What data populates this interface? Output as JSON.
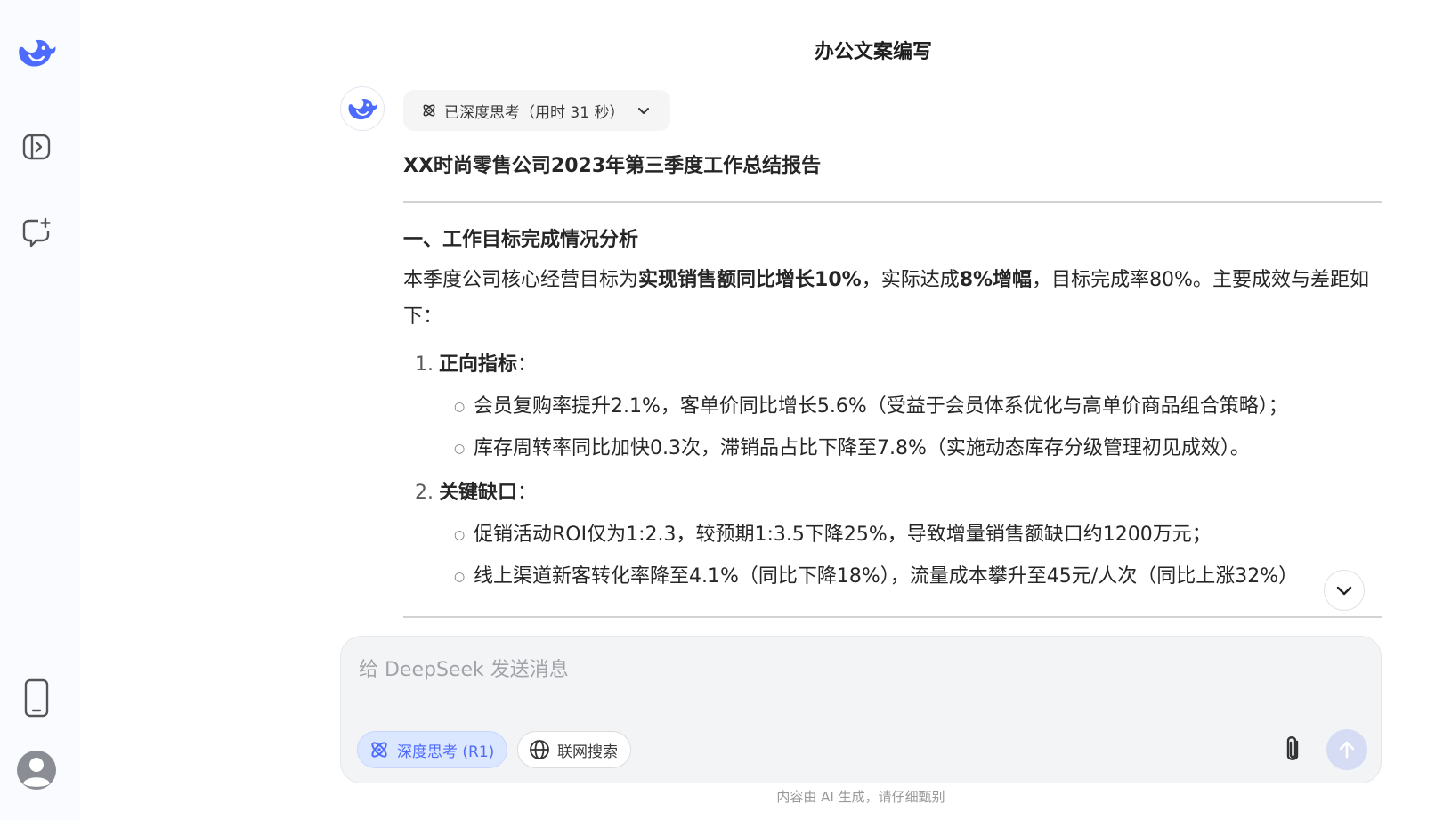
{
  "colors": {
    "accent": "#4d6bfe",
    "sidebar_bg": "#f9fbff",
    "text": "#262626"
  },
  "sidebar": {
    "logo_icon": "deepseek-whale-icon",
    "toggle_icon": "sidebar-toggle-icon",
    "new_chat_icon": "new-chat-icon",
    "mobile_icon": "mobile-phone-icon",
    "avatar_icon": "user-avatar-icon"
  },
  "page": {
    "title": "办公文案编写"
  },
  "message": {
    "think_label": "已深度思考（用时 31 秒）",
    "report_title": "XX时尚零售公司2023年第三季度工作总结报告",
    "section1_title": "一、工作目标完成情况分析",
    "intro": {
      "t1": "本季度公司核心经营目标为",
      "b1": "实现销售额同比增长10%",
      "t2": "，实际达成",
      "b2": "8%增幅",
      "t3": "，目标完成率80%。主要成效与差距如下："
    },
    "list": [
      {
        "num": "1.",
        "title": "正向指标",
        "suffix": "：",
        "items": [
          "会员复购率提升2.1%，客单价同比增长5.6%（受益于会员体系优化与高单价商品组合策略）；",
          "库存周转率同比加快0.3次，滞销品占比下降至7.8%（实施动态库存分级管理初见成效）。"
        ]
      },
      {
        "num": "2.",
        "title": "关键缺口",
        "suffix": "：",
        "items": [
          "促销活动ROI仅为1:2.3，较预期1:3.5下降25%，导致增量销售额缺口约1200万元；",
          "线上渠道新客转化率降至4.1%（同比下降18%），流量成本攀升至45元/人次（同比上涨32%）"
        ]
      }
    ]
  },
  "composer": {
    "placeholder": "给 DeepSeek 发送消息",
    "deep_think_label": "深度思考 (R1)",
    "web_search_label": "联网搜索"
  },
  "footer": {
    "disclaimer": "内容由 AI 生成，请仔细甄别"
  }
}
